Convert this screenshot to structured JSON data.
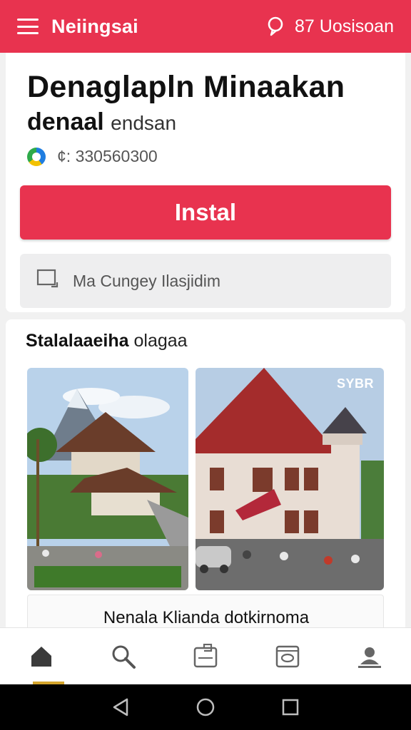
{
  "appbar": {
    "title": "Neiingsai",
    "right_text": "87 Uosisoan"
  },
  "app": {
    "title_line1": "Denaglapln Minaakan",
    "title_line2_bold": "denaal",
    "title_line2_rest": "endsan",
    "price": "¢: 330560300",
    "install_label": "Instal",
    "secondary_label": "Ma Cungey Ilasjidim"
  },
  "screenshots": {
    "section_title_bold": "Stala",
    "section_title_mid": "laaeiha",
    "section_title_rest": "olagaa",
    "tag": "SYBR",
    "caption": "Nenala Klianda dotkirnoma"
  },
  "bottom_nav": {
    "items": [
      "home-icon",
      "search-icon",
      "clipboard-icon",
      "media-icon",
      "profile-icon"
    ],
    "active": 0
  },
  "colors": {
    "accent": "#e8334f",
    "active_indicator": "#d4a52c"
  }
}
